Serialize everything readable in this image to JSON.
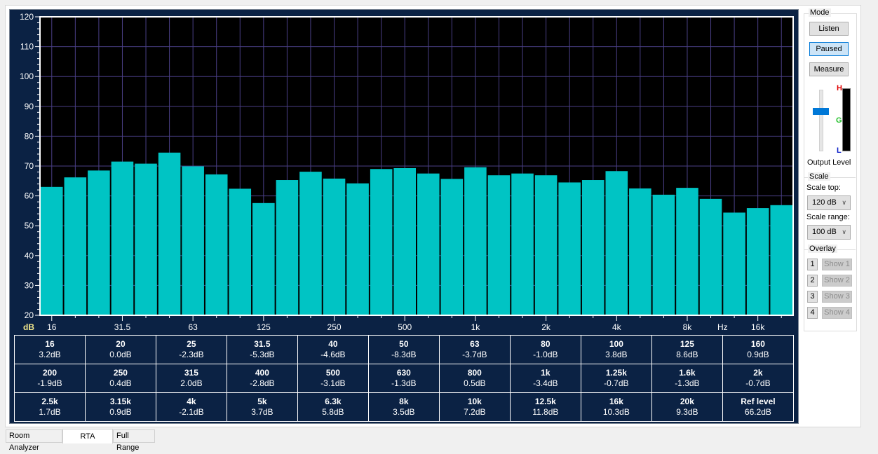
{
  "chart_data": {
    "type": "bar",
    "ylabel": "dB",
    "xlabel": "Hz",
    "ylim": [
      20,
      120
    ],
    "y_ticks": [
      "20",
      "30",
      "40",
      "50",
      "60",
      "70",
      "80",
      "90",
      "100",
      "110",
      "120"
    ],
    "x_tick_labels": [
      {
        "band": 0,
        "label": "16"
      },
      {
        "band": 3,
        "label": "31.5"
      },
      {
        "band": 6,
        "label": "63"
      },
      {
        "band": 9,
        "label": "125"
      },
      {
        "band": 12,
        "label": "250"
      },
      {
        "band": 15,
        "label": "500"
      },
      {
        "band": 18,
        "label": "1k"
      },
      {
        "band": 21,
        "label": "2k"
      },
      {
        "band": 24,
        "label": "4k"
      },
      {
        "band": 27,
        "label": "8k"
      },
      {
        "band": 28.5,
        "label": "Hz"
      },
      {
        "band": 30,
        "label": "16k"
      }
    ],
    "categories": [
      "16",
      "20",
      "25",
      "31.5",
      "40",
      "50",
      "63",
      "80",
      "100",
      "125",
      "160",
      "200",
      "250",
      "315",
      "400",
      "500",
      "630",
      "800",
      "1k",
      "1.25k",
      "1.6k",
      "2k",
      "2.5k",
      "3.15k",
      "4k",
      "5k",
      "6.3k",
      "8k",
      "10k",
      "12.5k",
      "16k",
      "20k"
    ],
    "values": [
      63.0,
      66.2,
      68.5,
      71.5,
      70.8,
      74.5,
      69.9,
      67.2,
      62.4,
      57.6,
      65.3,
      68.1,
      65.8,
      64.2,
      69.0,
      69.3,
      67.5,
      65.7,
      69.6,
      66.9,
      67.5,
      66.9,
      64.5,
      65.3,
      68.3,
      62.5,
      60.4,
      62.7,
      59.0,
      54.4,
      55.9,
      56.9
    ],
    "bar_color": "#00c4c4",
    "grid": true
  },
  "table": [
    {
      "f": "16",
      "v": "3.2dB"
    },
    {
      "f": "20",
      "v": "0.0dB"
    },
    {
      "f": "25",
      "v": "-2.3dB"
    },
    {
      "f": "31.5",
      "v": "-5.3dB"
    },
    {
      "f": "40",
      "v": "-4.6dB"
    },
    {
      "f": "50",
      "v": "-8.3dB"
    },
    {
      "f": "63",
      "v": "-3.7dB"
    },
    {
      "f": "80",
      "v": "-1.0dB"
    },
    {
      "f": "100",
      "v": "3.8dB"
    },
    {
      "f": "125",
      "v": "8.6dB"
    },
    {
      "f": "160",
      "v": "0.9dB"
    },
    {
      "f": "200",
      "v": "-1.9dB"
    },
    {
      "f": "250",
      "v": "0.4dB"
    },
    {
      "f": "315",
      "v": "2.0dB"
    },
    {
      "f": "400",
      "v": "-2.8dB"
    },
    {
      "f": "500",
      "v": "-3.1dB"
    },
    {
      "f": "630",
      "v": "-1.3dB"
    },
    {
      "f": "800",
      "v": "0.5dB"
    },
    {
      "f": "1k",
      "v": "-3.4dB"
    },
    {
      "f": "1.25k",
      "v": "-0.7dB"
    },
    {
      "f": "1.6k",
      "v": "-1.3dB"
    },
    {
      "f": "2k",
      "v": "-0.7dB"
    },
    {
      "f": "2.5k",
      "v": "1.7dB"
    },
    {
      "f": "3.15k",
      "v": "0.9dB"
    },
    {
      "f": "4k",
      "v": "-2.1dB"
    },
    {
      "f": "5k",
      "v": "3.7dB"
    },
    {
      "f": "6.3k",
      "v": "5.8dB"
    },
    {
      "f": "8k",
      "v": "3.5dB"
    },
    {
      "f": "10k",
      "v": "7.2dB"
    },
    {
      "f": "12.5k",
      "v": "11.8dB"
    },
    {
      "f": "16k",
      "v": "10.3dB"
    },
    {
      "f": "20k",
      "v": "9.3dB"
    },
    {
      "f": "Ref level",
      "v": "66.2dB"
    }
  ],
  "side": {
    "mode_title": "Mode",
    "listen": "Listen",
    "paused": "Paused",
    "measure": "Measure",
    "meter_h": "H",
    "meter_g": "G",
    "meter_l": "L",
    "output_level": "Output Level",
    "output_level_fraction": 0.55,
    "scale_title": "Scale",
    "scale_top_label": "Scale top:",
    "scale_top_value": "120 dB",
    "scale_range_label": "Scale range:",
    "scale_range_value": "100 dB",
    "overlay_title": "Overlay",
    "overlays": [
      {
        "n": "1",
        "show": "Show 1"
      },
      {
        "n": "2",
        "show": "Show 2"
      },
      {
        "n": "3",
        "show": "Show 3"
      },
      {
        "n": "4",
        "show": "Show 4"
      }
    ]
  },
  "tabs": [
    "Room Analyzer",
    "RTA",
    "Full Range"
  ],
  "colors": {
    "panel": "#0b2244",
    "grid": "#4a3f86",
    "accent": "#0078d7"
  }
}
